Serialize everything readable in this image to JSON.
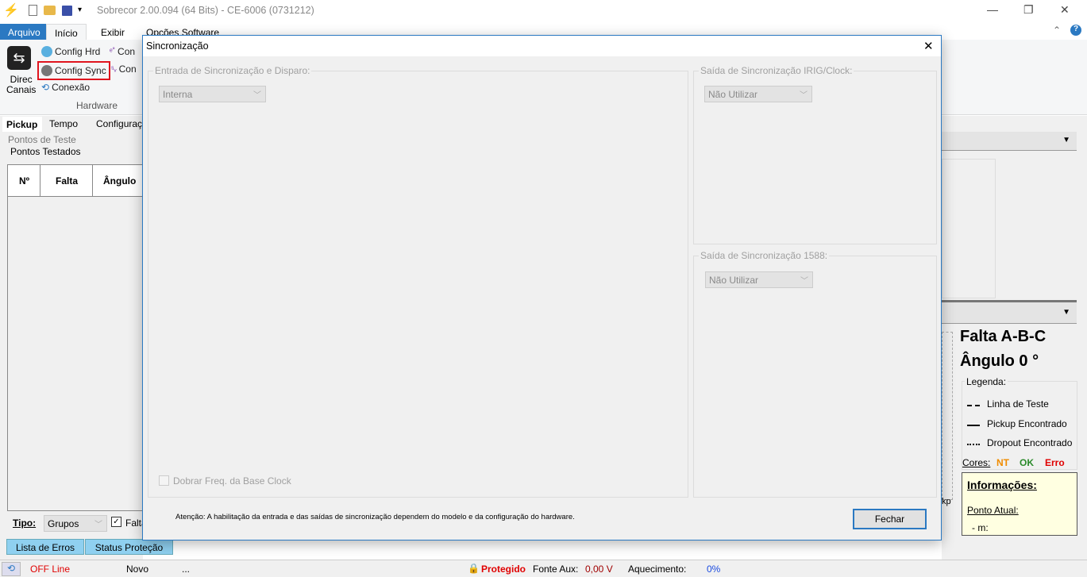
{
  "app": {
    "title": "Sobrecor 2.00.094 (64 Bits) - CE-6006 (0731212)"
  },
  "ribbon": {
    "tabs": [
      "Arquivo",
      "Início",
      "Exibir",
      "Opções Software"
    ],
    "direc_line1": "Direc",
    "direc_line2": "Canais",
    "config_hrd": "Config Hrd",
    "config_sync": "Config Sync",
    "conexao": "Conexão",
    "cont1": "Con",
    "cont2": "Con",
    "group": "Hardware"
  },
  "left": {
    "tabs": [
      "Pickup",
      "Tempo",
      "Configuraçõ"
    ],
    "section": "Pontos de Teste",
    "group": "Pontos Testados",
    "columns": [
      "Nº",
      "Falta",
      "Ângulo"
    ],
    "tipo_label": "Tipo:",
    "tipo_value": "Grupos",
    "falta_check": "Falta",
    "bottom_tabs": [
      "Lista de Erros",
      "Status Proteção"
    ]
  },
  "right": {
    "falta": "Falta A-B-C",
    "angulo": "Ângulo 0 °",
    "legenda": "Legenda:",
    "legend": [
      {
        "line": "dashed",
        "label": "Linha de Teste"
      },
      {
        "line": "solid",
        "label": "Pickup Encontrado"
      },
      {
        "line": "dashdot",
        "label": "Dropout Encontrado"
      }
    ],
    "cores": "Cores:",
    "nt": "NT",
    "ok": "OK",
    "erro": "Erro",
    "info": "Informações:",
    "ponto": "Ponto Atual:",
    "m": "- m:",
    "kp": "kp",
    "colors": {
      "nt": "#f08c00",
      "ok": "#2a8a2a",
      "erro": "#e00000"
    }
  },
  "dialog": {
    "title": "Sincronização",
    "close": "✕",
    "entrada": {
      "label": "Entrada de Sincronização e Disparo:",
      "value": "Interna"
    },
    "irig": {
      "label": "Saída de Sincronização IRIG/Clock:",
      "value": "Não Utilizar"
    },
    "s1588": {
      "label": "Saída de Sincronização 1588:",
      "value": "Não Utilizar"
    },
    "dobrar": "Dobrar Freq. da Base Clock",
    "note": "Atenção: A habilitação da entrada e das saídas de sincronização dependem do modelo e da configuração do hardware.",
    "fechar": "Fechar"
  },
  "status": {
    "mode": "OFF Line",
    "file": "Novo",
    "msg": "...",
    "protegido": "Protegido",
    "fonte_label": "Fonte Aux:",
    "fonte_value": "0,00 V",
    "aquec_label": "Aquecimento:",
    "aquec_value": "0%"
  }
}
